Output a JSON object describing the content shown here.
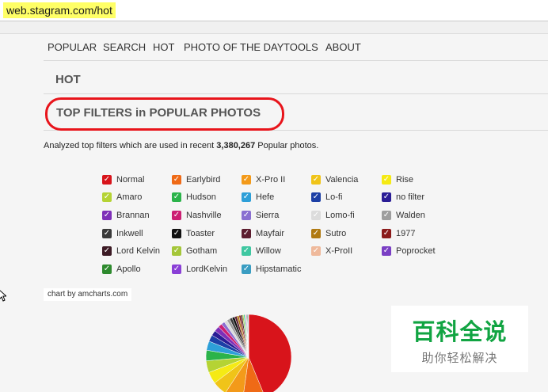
{
  "browser": {
    "url": "web.stagram.com/hot"
  },
  "nav": {
    "items": [
      "POPULAR",
      "SEARCH",
      "HOT",
      "PHOTO OF THE DAY",
      "TOOLS",
      "ABOUT"
    ]
  },
  "page": {
    "section_title": "HOT",
    "filters_title": "TOP FILTERS in POPULAR PHOTOS",
    "analyzed_prefix": "Analyzed top filters which are used in recent ",
    "analyzed_count": "3,380,267",
    "analyzed_suffix": " Popular photos."
  },
  "chart_credit": "chart by amcharts.com",
  "watermark": {
    "title": "百科全说",
    "subtitle": "助你轻松解决"
  },
  "chart_data": {
    "type": "pie",
    "legend_position": "top",
    "series": [
      {
        "name": "Normal",
        "color": "#d8141b"
      },
      {
        "name": "Earlybird",
        "color": "#ef6a16"
      },
      {
        "name": "X-Pro II",
        "color": "#f39a1a"
      },
      {
        "name": "Valencia",
        "color": "#f0c419"
      },
      {
        "name": "Rise",
        "color": "#f5ea14"
      },
      {
        "name": "Amaro",
        "color": "#b5d334"
      },
      {
        "name": "Hudson",
        "color": "#2bb34a"
      },
      {
        "name": "Hefe",
        "color": "#2d9fd8"
      },
      {
        "name": "Lo-fi",
        "color": "#1c3fa6"
      },
      {
        "name": "no filter",
        "color": "#2a1d96"
      },
      {
        "name": "Brannan",
        "color": "#7e2fb8"
      },
      {
        "name": "Nashville",
        "color": "#cc1f73"
      },
      {
        "name": "Sierra",
        "color": "#8a6fd1"
      },
      {
        "name": "Lomo-fi",
        "color": "#dcdcdc"
      },
      {
        "name": "Walden",
        "color": "#9e9e9e"
      },
      {
        "name": "Inkwell",
        "color": "#3a3a3a"
      },
      {
        "name": "Toaster",
        "color": "#111111"
      },
      {
        "name": "Mayfair",
        "color": "#5c1c2e"
      },
      {
        "name": "Sutro",
        "color": "#b07a12"
      },
      {
        "name": "1977",
        "color": "#8b1a1a"
      },
      {
        "name": "Lord Kelvin",
        "color": "#3c1a24"
      },
      {
        "name": "Gotham",
        "color": "#a4c639"
      },
      {
        "name": "Willow",
        "color": "#3fc7a1"
      },
      {
        "name": "X-ProII",
        "color": "#efb99b"
      },
      {
        "name": "Poprocket",
        "color": "#7a3fc4"
      },
      {
        "name": "Apollo",
        "color": "#2e8a2e"
      },
      {
        "name": "LordKelvin",
        "color": "#8a3fd6"
      },
      {
        "name": "Hipstamatic",
        "color": "#3a9dc2"
      }
    ],
    "slices": [
      {
        "name": "Normal",
        "value": 44.0
      },
      {
        "name": "Earlybird",
        "value": 8.5
      },
      {
        "name": "X-Pro II",
        "value": 7.0
      },
      {
        "name": "Valencia",
        "value": 5.5
      },
      {
        "name": "Rise",
        "value": 4.5
      },
      {
        "name": "Amaro",
        "value": 4.5
      },
      {
        "name": "Hudson",
        "value": 4.0
      },
      {
        "name": "Hefe",
        "value": 3.5
      },
      {
        "name": "Lo-fi",
        "value": 2.5
      },
      {
        "name": "no filter",
        "value": 2.0
      },
      {
        "name": "Brannan",
        "value": 2.0
      },
      {
        "name": "Nashville",
        "value": 1.5
      },
      {
        "name": "Sierra",
        "value": 1.3
      },
      {
        "name": "Lomo-fi",
        "value": 1.2
      },
      {
        "name": "Walden",
        "value": 1.1
      },
      {
        "name": "Inkwell",
        "value": 1.0
      },
      {
        "name": "Toaster",
        "value": 1.0
      },
      {
        "name": "Mayfair",
        "value": 0.9
      },
      {
        "name": "Sutro",
        "value": 0.8
      },
      {
        "name": "1977",
        "value": 0.7
      },
      {
        "name": "Lord Kelvin",
        "value": 0.6
      },
      {
        "name": "Gotham",
        "value": 0.5
      },
      {
        "name": "Willow",
        "value": 0.5
      },
      {
        "name": "X-ProII",
        "value": 0.4
      },
      {
        "name": "Poprocket",
        "value": 0.3
      },
      {
        "name": "Apollo",
        "value": 0.3
      },
      {
        "name": "LordKelvin",
        "value": 0.2
      },
      {
        "name": "Hipstamatic",
        "value": 0.2
      }
    ]
  }
}
